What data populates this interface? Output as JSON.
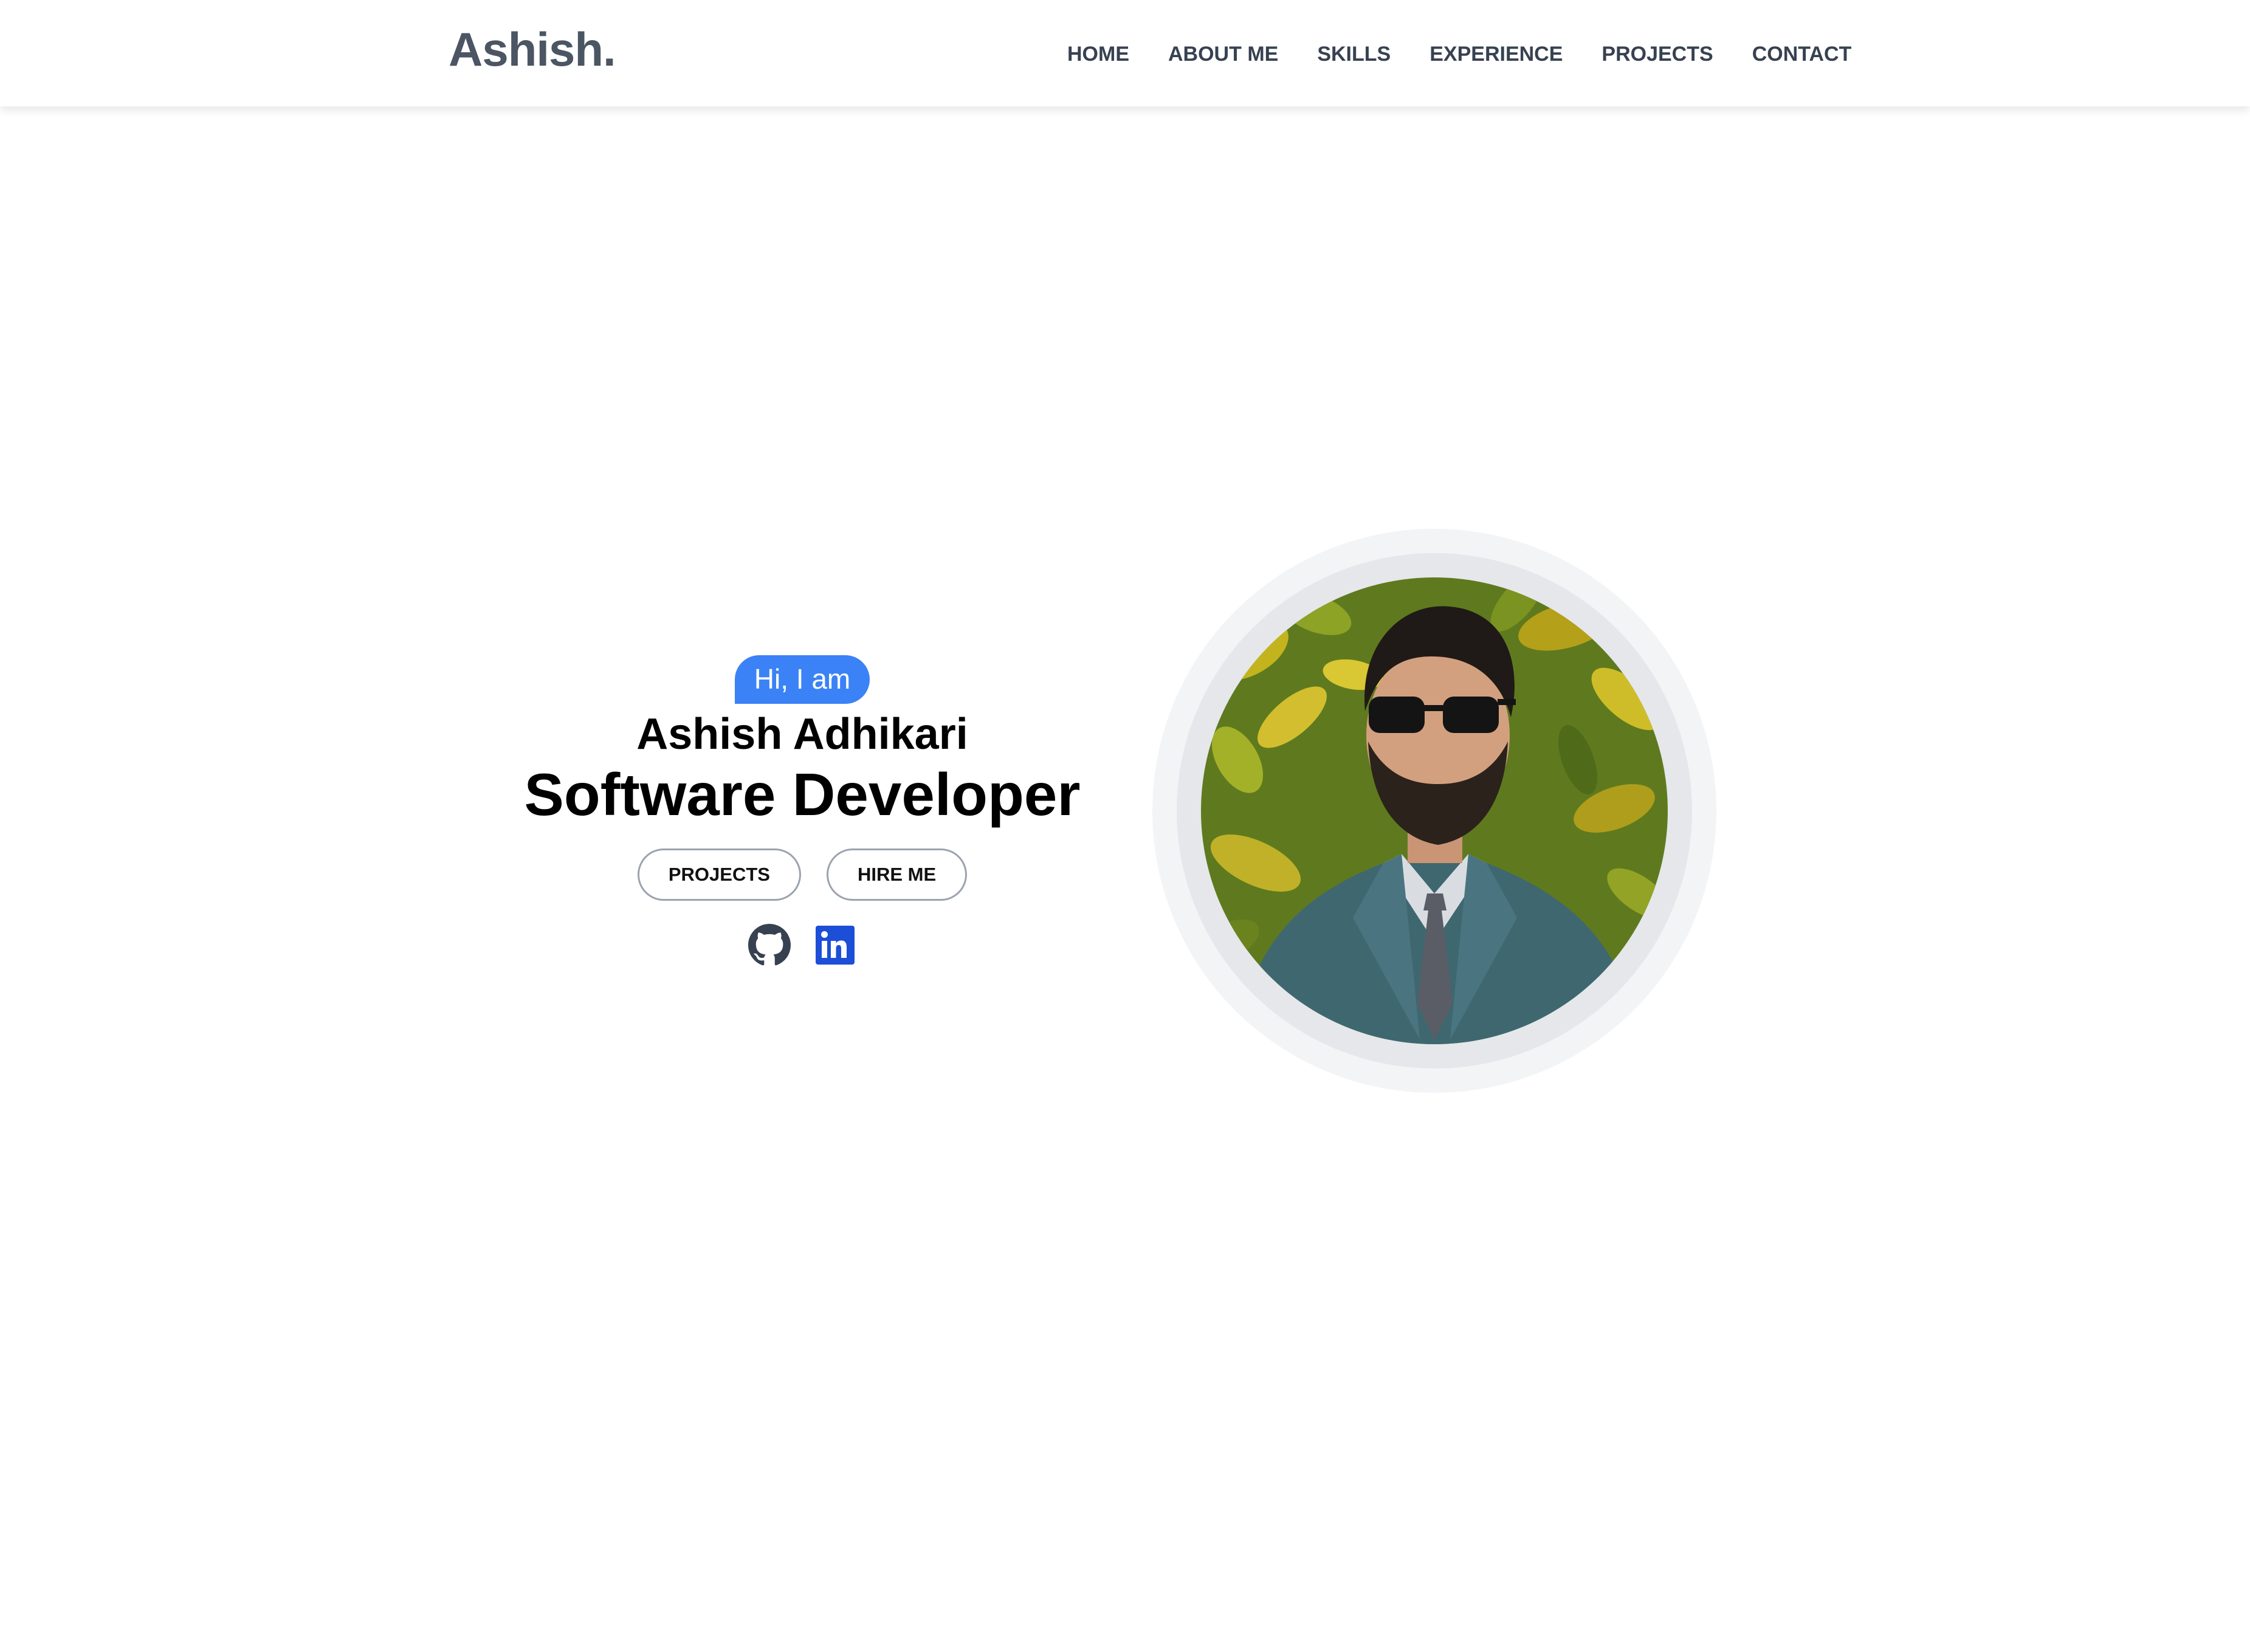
{
  "header": {
    "brand": "Ashish.",
    "nav": [
      {
        "label": "HOME"
      },
      {
        "label": "ABOUT ME"
      },
      {
        "label": "SKILLS"
      },
      {
        "label": "EXPERIENCE"
      },
      {
        "label": "PROJECTS"
      },
      {
        "label": "CONTACT"
      }
    ]
  },
  "hero": {
    "greeting": "Hi, I am",
    "name": "Ashish Adhikari",
    "role": "Software Developer",
    "buttons": {
      "projects": "PROJECTS",
      "hire": "HIRE ME"
    },
    "social": [
      {
        "icon": "github-icon"
      },
      {
        "icon": "linkedin-icon"
      }
    ]
  },
  "colors": {
    "accent": "#3b82f6",
    "nav_text": "#374151",
    "brand_text": "#4b5563",
    "linkedin": "#1d4ed8",
    "ring_outer": "#f3f4f6",
    "ring_inner": "#e5e7eb"
  }
}
